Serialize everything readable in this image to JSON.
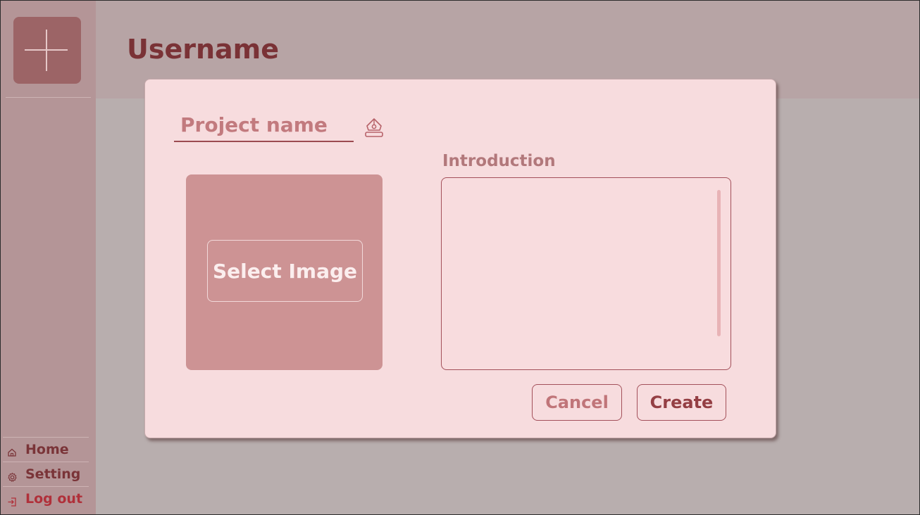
{
  "header": {
    "username": "Username"
  },
  "sidebar": {
    "add_icon": "plus-icon",
    "items": [
      {
        "label": "Home",
        "icon": "home-icon"
      },
      {
        "label": "Setting",
        "icon": "gear-icon"
      },
      {
        "label": "Log out",
        "icon": "logout-icon"
      }
    ]
  },
  "modal": {
    "project_name": "Project name",
    "edit_icon": "edit-icon",
    "select_image_label": "Select Image",
    "introduction_label": "Introduction",
    "introduction_value": "",
    "cancel_label": "Cancel",
    "create_label": "Create"
  },
  "colors": {
    "background": "#b8aeae",
    "sidebar": "#b49597",
    "header": "#b7a4a5",
    "modal": "#f7dcde",
    "accent": "#9c6466",
    "title_text": "#7a3236",
    "logout_text": "#b0303a"
  }
}
